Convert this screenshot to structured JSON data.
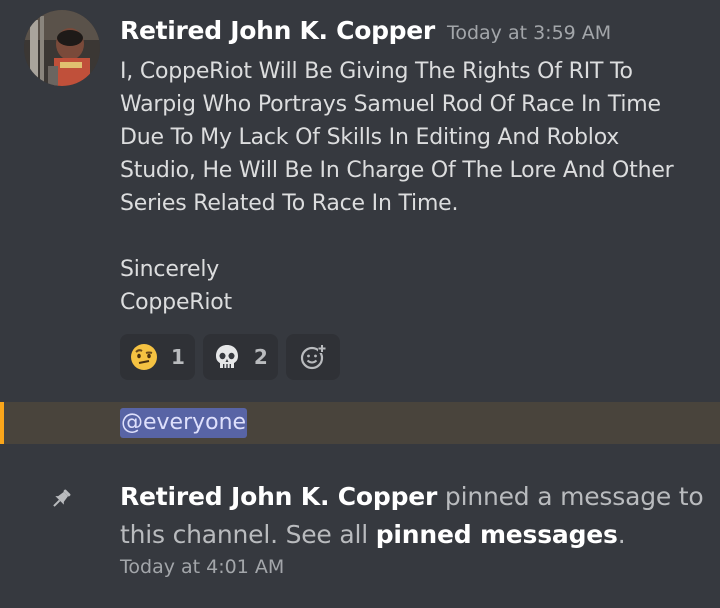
{
  "message": {
    "author": "Retired John K. Copper",
    "timestamp": "Today at 3:59 AM",
    "lines": [
      "I, CoppeRiot Will Be Giving The Rights Of RIT To",
      "Warpig Who Portrays Samuel Rod Of Race In Time",
      "Due To My Lack Of Skills In Editing And Roblox",
      "Studio, He Will Be In Charge Of The Lore And Other",
      "Series Related To Race In Time."
    ],
    "signoff": "Sincerely",
    "signature": "CoppeRiot",
    "reactions": [
      {
        "emoji": "face-with-raised-eyebrow-icon",
        "count": "1"
      },
      {
        "emoji": "skull-icon",
        "count": "2"
      }
    ]
  },
  "mention": {
    "text": "@everyone",
    "highlight_color": "#faa61a"
  },
  "system_message": {
    "author": "Retired John K. Copper",
    "text_before": " pinned a message to this channel. See all ",
    "link": "pinned messages",
    "text_after": ".",
    "timestamp": "Today at 4:01 AM"
  },
  "colors": {
    "background": "#36393f",
    "mention_bg": "#5864a5",
    "mention_row_bg": "#49443c"
  }
}
